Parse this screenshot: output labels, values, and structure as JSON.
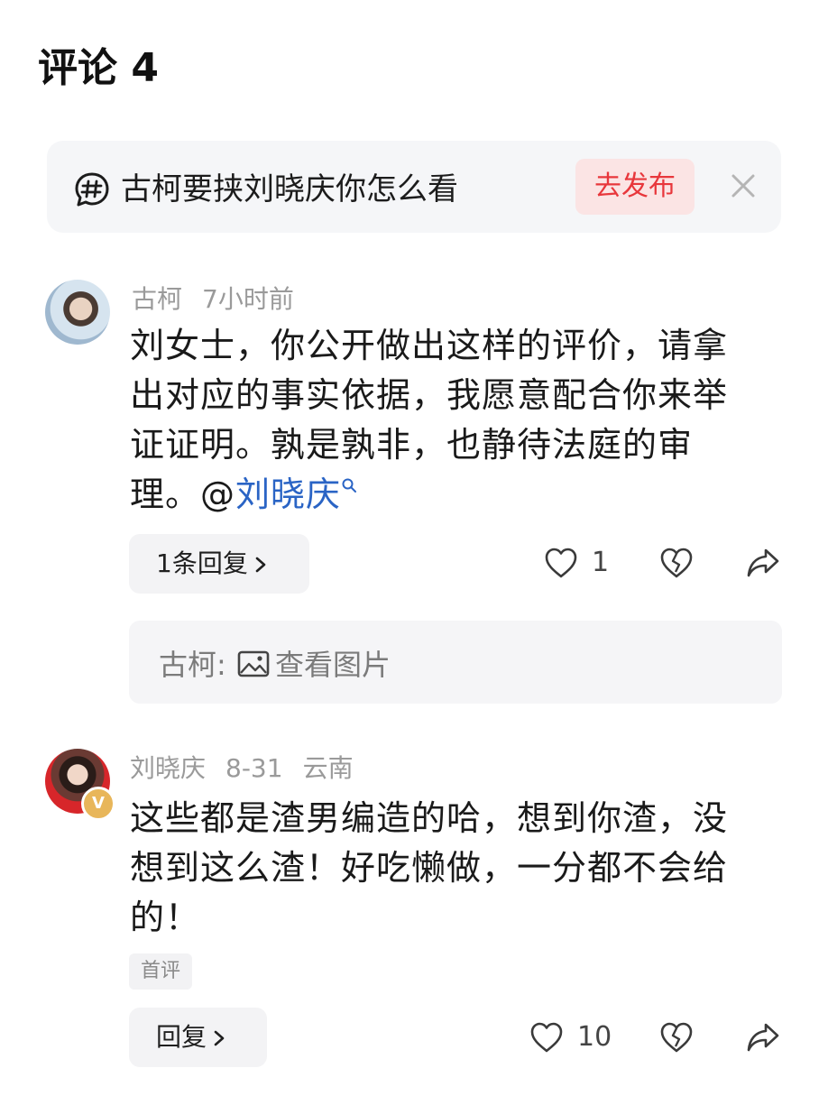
{
  "header": {
    "title": "评论 4"
  },
  "topic": {
    "text": "古柯要挟刘晓庆你怎么看",
    "publish_label": "去发布",
    "icon": "hashtag-icon",
    "close_icon": "close-icon"
  },
  "comments": [
    {
      "author": "古柯",
      "time": "7小时前",
      "location": "",
      "body_lines": [
        "刘女士，你公开做出这样的评价，请拿",
        "出对应的事实依据，我愿意配合你来举",
        "证证明。孰是孰非，也静待法庭的审"
      ],
      "body_last_prefix": "理。@",
      "mention": "刘晓庆",
      "reply_label": "1条回复",
      "likes": "1",
      "sub_reply": {
        "author": "古柯:",
        "text": "查看图片"
      }
    },
    {
      "author": "刘晓庆",
      "time": "8-31",
      "location": "云南",
      "verified_badge": "V",
      "body_lines": [
        "这些都是渣男编造的哈，想到你渣，没",
        "想到这么渣！好吃懒做，一分都不会给",
        "的！"
      ],
      "tag": "首评",
      "reply_label": "回复",
      "likes": "10"
    }
  ],
  "colors": {
    "accent_red": "#e8373c",
    "mention_blue": "#2a64c5",
    "meta_gray": "#9a9a9a"
  }
}
